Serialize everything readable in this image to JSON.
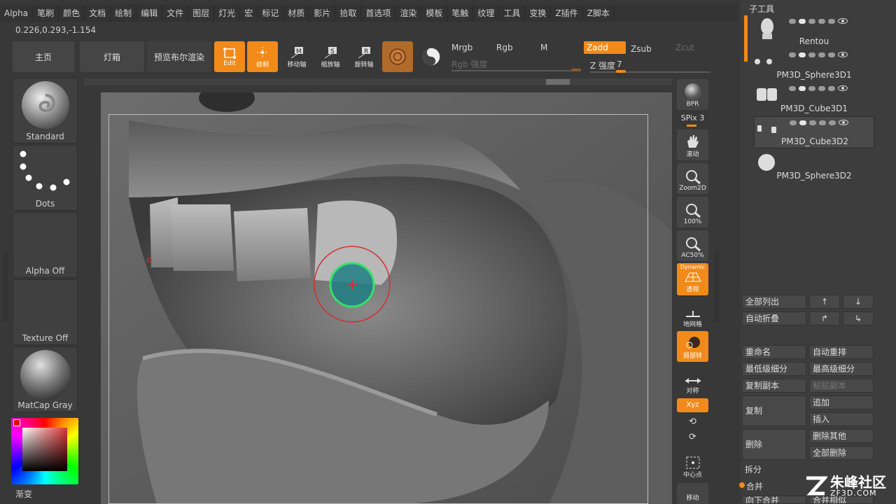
{
  "menu": [
    "Alpha",
    "笔刷",
    "颜色",
    "文档",
    "绘制",
    "编辑",
    "文件",
    "图层",
    "灯光",
    "宏",
    "标记",
    "材质",
    "影片",
    "拾取",
    "首选项",
    "渲染",
    "模板",
    "笔触",
    "纹理",
    "工具",
    "变换",
    "Z插件",
    "Z脚本"
  ],
  "coords": "0.226,0.293,-1.154",
  "toolbar": {
    "home": "主页",
    "lightbox": "灯箱",
    "bpr_preview": "预览布尔渲染",
    "edit": "Edit",
    "draw": "绘制",
    "move": "移动轴",
    "scale": "缩放轴",
    "rotate": "旋转轴",
    "mrgb": "Mrgb",
    "rgb": "Rgb",
    "m": "M",
    "zadd": "Zadd",
    "zsub": "Zsub",
    "zcut": "Zcut",
    "rgb_intensity": "Rgb 强度",
    "z_intensity_label": "Z 强度",
    "z_intensity_value": "7"
  },
  "left_palette": {
    "brush": "Standard",
    "stroke": "Dots",
    "alpha": "Alpha Off",
    "texture": "Texture Off",
    "material": "MatCap Gray",
    "gradient": "渐变"
  },
  "right_toolbar": {
    "bpr": "BPR",
    "spix_label": "SPix",
    "spix_value": "3",
    "scroll": "滚动",
    "zoom2d": "Zoom2D",
    "zoom100": "100%",
    "ac50": "AC50%",
    "dynamic": "Dynamic",
    "perspective": "透视",
    "floor": "地网格",
    "local": "局部转",
    "symmetry": "对称",
    "xyz": "Xyz",
    "center": "中心点",
    "move_canvas": "移动"
  },
  "subtool": {
    "header": "子工具",
    "items": [
      {
        "name": "Rentou"
      },
      {
        "name": "PM3D_Sphere3D1"
      },
      {
        "name": "PM3D_Cube3D1"
      },
      {
        "name": "PM3D_Cube3D2"
      },
      {
        "name": "PM3D_Sphere3D2"
      }
    ],
    "list_all": "全部列出",
    "auto_collapse": "自动折叠",
    "rename": "重命名",
    "auto_reorder": "自动重排",
    "lowest_subdiv": "最低级细分",
    "highest_subdiv": "最高级细分",
    "duplicate": "复制副本",
    "paste_copy": "粘贴副本",
    "copy": "复制",
    "append": "追加",
    "insert": "插入",
    "delete": "删除",
    "delete_other": "删除其他",
    "delete_all": "全部删除",
    "split": "拆分",
    "merge": "合并",
    "merge_down": "向下合并",
    "merge_similar": "合并相似"
  },
  "watermark": {
    "cn": "朱峰社区",
    "en": "ZF3D.COM"
  }
}
